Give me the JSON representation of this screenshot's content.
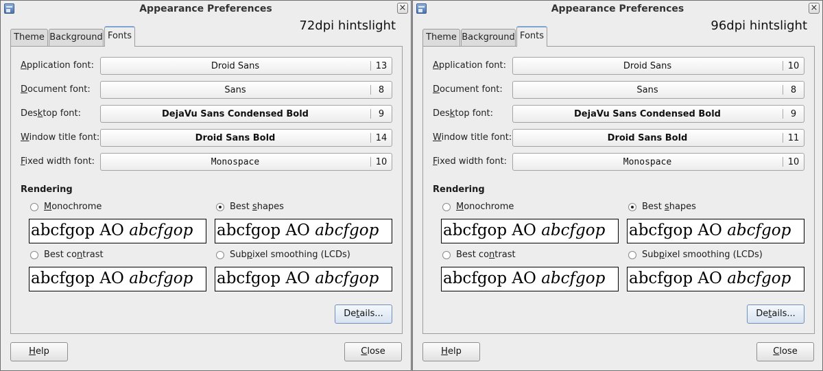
{
  "windows": [
    {
      "title": "Appearance Preferences",
      "dpi_label": "72dpi hintslight",
      "tabs": [
        "Theme",
        "Background",
        "Fonts"
      ],
      "fonts": [
        {
          "label_pre": "",
          "label_u": "A",
          "label_post": "pplication font:",
          "name": "Droid Sans",
          "size": "13"
        },
        {
          "label_pre": "",
          "label_u": "D",
          "label_post": "ocument font:",
          "name": "Sans",
          "size": "8"
        },
        {
          "label_pre": "Des",
          "label_u": "k",
          "label_post": "top font:",
          "name": "DejaVu Sans Condensed Bold",
          "size": "9"
        },
        {
          "label_pre": "",
          "label_u": "W",
          "label_post": "indow title font:",
          "name": "Droid Sans Bold",
          "size": "14"
        },
        {
          "label_pre": "",
          "label_u": "F",
          "label_post": "ixed width font:",
          "name": "Monospace",
          "size": "10"
        }
      ],
      "rendering_title": "Rendering",
      "options": [
        {
          "pre": "",
          "u": "M",
          "post": "onochrome",
          "selected": false
        },
        {
          "pre": "Best ",
          "u": "s",
          "post": "hapes",
          "selected": true
        },
        {
          "pre": "Best co",
          "u": "n",
          "post": "trast",
          "selected": false
        },
        {
          "pre": "Sub",
          "u": "p",
          "post": "ixel smoothing (LCDs)",
          "selected": false
        }
      ],
      "sample_text": "abcfgop AO ",
      "sample_italic": "abcfgop",
      "details": {
        "pre": "De",
        "u": "t",
        "post": "ails..."
      },
      "help": {
        "pre": "",
        "u": "H",
        "post": "elp"
      },
      "close": {
        "pre": "",
        "u": "C",
        "post": "lose"
      }
    },
    {
      "title": "Appearance Preferences",
      "dpi_label": "96dpi hintslight",
      "tabs": [
        "Theme",
        "Background",
        "Fonts"
      ],
      "fonts": [
        {
          "label_pre": "",
          "label_u": "A",
          "label_post": "pplication font:",
          "name": "Droid Sans",
          "size": "10"
        },
        {
          "label_pre": "",
          "label_u": "D",
          "label_post": "ocument font:",
          "name": "Sans",
          "size": "8"
        },
        {
          "label_pre": "Des",
          "label_u": "k",
          "label_post": "top font:",
          "name": "DejaVu Sans Condensed Bold",
          "size": "9"
        },
        {
          "label_pre": "",
          "label_u": "W",
          "label_post": "indow title font:",
          "name": "Droid Sans Bold",
          "size": "11"
        },
        {
          "label_pre": "",
          "label_u": "F",
          "label_post": "ixed width font:",
          "name": "Monospace",
          "size": "10"
        }
      ],
      "rendering_title": "Rendering",
      "options": [
        {
          "pre": "",
          "u": "M",
          "post": "onochrome",
          "selected": false
        },
        {
          "pre": "Best ",
          "u": "s",
          "post": "hapes",
          "selected": true
        },
        {
          "pre": "Best co",
          "u": "n",
          "post": "trast",
          "selected": false
        },
        {
          "pre": "Sub",
          "u": "p",
          "post": "ixel smoothing (LCDs)",
          "selected": false
        }
      ],
      "sample_text": "abcfgop AO ",
      "sample_italic": "abcfgop",
      "details": {
        "pre": "De",
        "u": "t",
        "post": "ails..."
      },
      "help": {
        "pre": "",
        "u": "H",
        "post": "elp"
      },
      "close": {
        "pre": "",
        "u": "C",
        "post": "lose"
      }
    }
  ]
}
